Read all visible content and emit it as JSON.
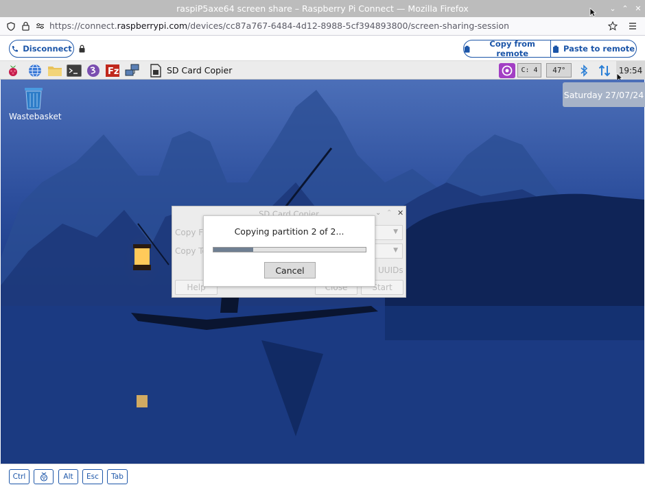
{
  "window": {
    "title": "raspiP5axe64 screen share – Raspberry Pi Connect — Mozilla Firefox"
  },
  "browser": {
    "url_prefix": "https://connect.",
    "url_domain": "raspberrypi.com",
    "url_path": "/devices/cc87a767-6484-4d12-8988-5cf394893800/screen-sharing-session"
  },
  "connect": {
    "disconnect_label": "Disconnect",
    "copy_from_remote_label": "Copy from remote",
    "paste_to_remote_label": "Paste to remote"
  },
  "taskbar": {
    "active_window_label": "SD Card Copier",
    "cpu_label": "C: 4",
    "temp_label": "47°",
    "clock": "19:54"
  },
  "desktop": {
    "wastebasket_label": "Wastebasket",
    "date_popup": "Saturday 27/07/24"
  },
  "sd_copier": {
    "title": "SD Card Copier",
    "copy_from_label": "Copy Fr",
    "copy_to_label": "Copy To",
    "uuids_label": "UUIDs",
    "help_label": "Help",
    "close_label": "Close",
    "start_label": "Start"
  },
  "progress_dialog": {
    "message": "Copying partition 2 of 2...",
    "progress_fraction": 0.26,
    "cancel_label": "Cancel"
  },
  "keys": {
    "ctrl": "Ctrl",
    "alt": "Alt",
    "esc": "Esc",
    "tab": "Tab"
  }
}
